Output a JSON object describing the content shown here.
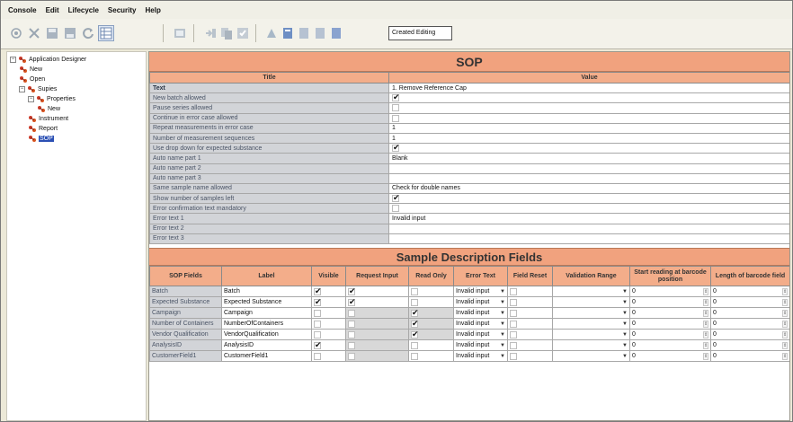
{
  "menu": [
    "Console",
    "Edit",
    "Lifecycle",
    "Security",
    "Help"
  ],
  "toolbar": {
    "icons_left": [
      "sop-icon",
      "cut-icon",
      "save-icon",
      "save-all-icon",
      "refresh-icon",
      "grid-icon"
    ],
    "icons_right": [
      "open-icon",
      "import-icon",
      "copy-icon",
      "validate-icon",
      "publish-icon",
      "book-icon",
      "book2-icon",
      "book3-icon"
    ],
    "status": "Created Editing"
  },
  "tree": {
    "items": [
      {
        "label": "Application Designer",
        "level": 0,
        "toggle": "−"
      },
      {
        "label": "New",
        "level": 1
      },
      {
        "label": "Open",
        "level": 1
      },
      {
        "label": "Supies",
        "level": 1,
        "toggle": "−"
      },
      {
        "label": "Properties",
        "level": 2,
        "toggle": "−"
      },
      {
        "label": "New",
        "level": 3
      },
      {
        "label": "Instrument",
        "level": 2
      },
      {
        "label": "Report",
        "level": 2
      },
      {
        "label": "SOP",
        "level": 2,
        "selected": true
      }
    ]
  },
  "sop": {
    "banner": "SOP",
    "col_title": "Title",
    "col_value": "Value",
    "rows": [
      {
        "title": "Text",
        "value": "1. Remove Reference Cap",
        "type": "text",
        "bold": true
      },
      {
        "title": "New batch allowed",
        "value": true,
        "type": "check"
      },
      {
        "title": "Pause series allowed",
        "value": false,
        "type": "check"
      },
      {
        "title": "Continue in error case allowed",
        "value": false,
        "type": "check"
      },
      {
        "title": "Repeat measurements in error case",
        "value": "1",
        "type": "text"
      },
      {
        "title": "Number of measurement sequences",
        "value": "1",
        "type": "text"
      },
      {
        "title": "Use drop down for expected substance",
        "value": true,
        "type": "check"
      },
      {
        "title": "Auto name part 1",
        "value": "Blank",
        "type": "text"
      },
      {
        "title": "Auto name part 2",
        "value": "",
        "type": "text"
      },
      {
        "title": "Auto name part 3",
        "value": "",
        "type": "text"
      },
      {
        "title": "Same sample name allowed",
        "value": "Check for double names",
        "type": "text"
      },
      {
        "title": "Show number of samples left",
        "value": true,
        "type": "check"
      },
      {
        "title": "Error confirmation text mandatory",
        "value": false,
        "type": "check"
      },
      {
        "title": "Error text 1",
        "value": "Invalid input",
        "type": "text"
      },
      {
        "title": "Error text 2",
        "value": "",
        "type": "text"
      },
      {
        "title": "Error text 3",
        "value": "",
        "type": "text"
      }
    ]
  },
  "fields": {
    "banner": "Sample Description Fields",
    "headers": [
      "SOP Fields",
      "Label",
      "Visible",
      "Request Input",
      "Read Only",
      "Error Text",
      "Field Reset",
      "Validation Range",
      "Start reading at barcode position",
      "Length of barcode field"
    ],
    "rows": [
      {
        "field": "Batch",
        "label": "Batch",
        "visible": true,
        "request": true,
        "readonly": false,
        "error": "Invalid input",
        "reset": false,
        "start": "0",
        "length": "0"
      },
      {
        "field": "Expected Substance",
        "label": "Expected Substance",
        "visible": true,
        "request": true,
        "readonly": false,
        "error": "Invalid input",
        "reset": false,
        "start": "0",
        "length": "0"
      },
      {
        "field": "Campaign",
        "label": "Campaign",
        "visible": false,
        "request": false,
        "readonly": true,
        "error": "Invalid input",
        "reset": false,
        "start": "0",
        "length": "0"
      },
      {
        "field": "Number of Containers",
        "label": "NumberOfContainers",
        "visible": false,
        "request": false,
        "readonly": true,
        "error": "Invalid input",
        "reset": false,
        "start": "0",
        "length": "0"
      },
      {
        "field": "Vendor Qualification",
        "label": "VendorQualification",
        "visible": false,
        "request": false,
        "readonly": true,
        "error": "Invalid input",
        "reset": false,
        "start": "0",
        "length": "0"
      },
      {
        "field": "AnalysisID",
        "label": "AnalysisID",
        "visible": true,
        "request": false,
        "readonly": false,
        "error": "Invalid input",
        "reset": false,
        "start": "0",
        "length": "0"
      },
      {
        "field": "CustomerField1",
        "label": "CustomerField1",
        "visible": false,
        "request": false,
        "readonly": false,
        "error": "Invalid input",
        "reset": false,
        "start": "0",
        "length": "0"
      }
    ]
  },
  "colors": {
    "accent": "#f1a27e",
    "header": "#f3ad8a",
    "title_cell": "#d2d4d8",
    "selection": "#2b50b4"
  }
}
